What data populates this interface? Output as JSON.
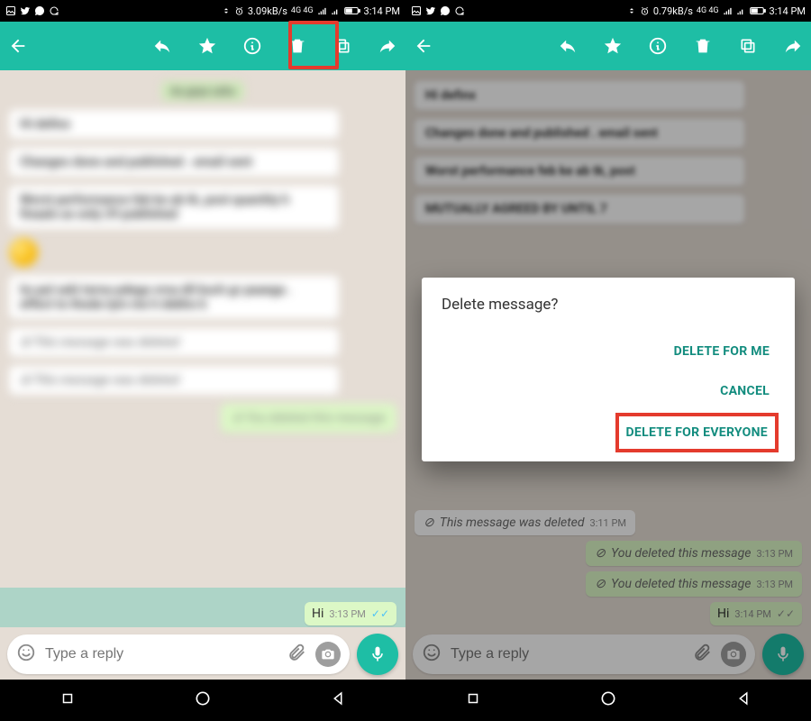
{
  "status": {
    "speed_left": "3.09kB/s",
    "speed_right": "0.79kB/s",
    "net": "4G 4G",
    "time": "3:14 PM"
  },
  "left": {
    "hi": "Hi",
    "hi_time": "3:13 PM",
    "placeholder": "Type a reply"
  },
  "right": {
    "deleted_in": "This message was deleted",
    "deleted_in_time": "3:11 PM",
    "deleted_out": "You deleted this message",
    "deleted_out_time1": "3:13 PM",
    "deleted_out_time2": "3:13 PM",
    "hi": "Hi",
    "hi_time": "3:14 PM",
    "placeholder": "Type a reply"
  },
  "dialog": {
    "title": "Delete message?",
    "delete_me": "DELETE FOR ME",
    "cancel": "CANCEL",
    "delete_all": "DELETE FOR EVERYONE"
  }
}
